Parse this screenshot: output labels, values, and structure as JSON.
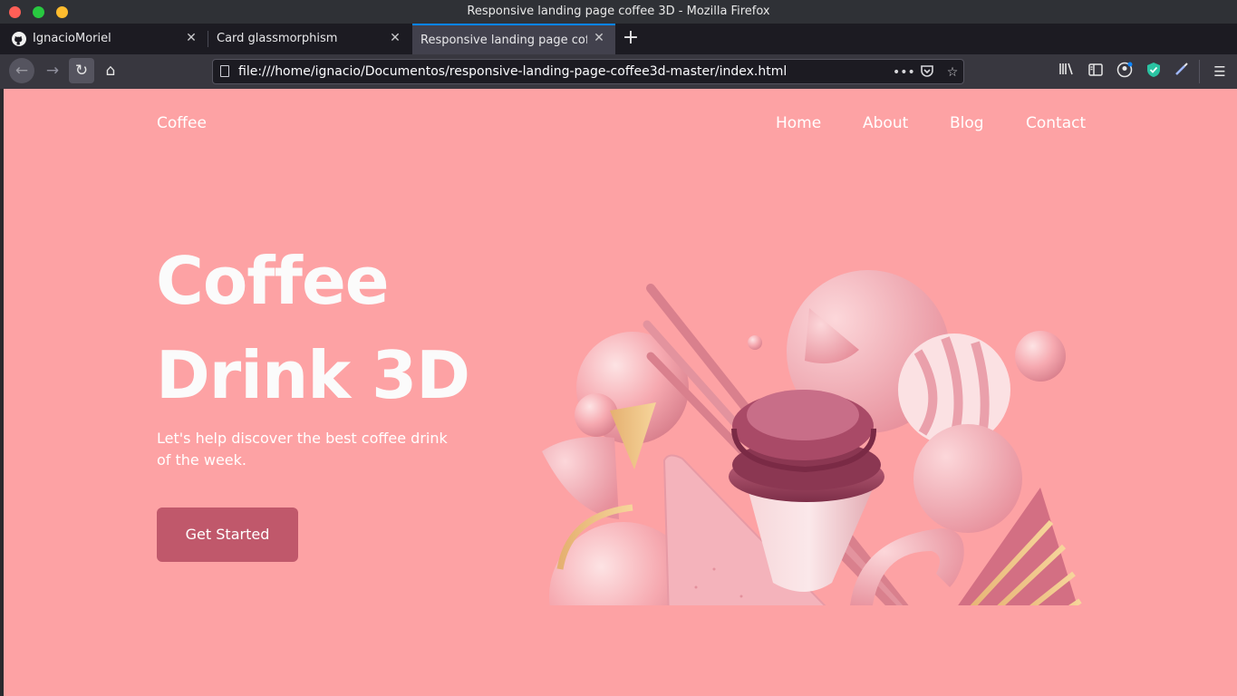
{
  "window": {
    "title": "Responsive landing page coffee 3D - Mozilla Firefox"
  },
  "tabs": [
    {
      "label": "IgnacioMoriel",
      "icon": "github-icon"
    },
    {
      "label": "Card glassmorphism"
    },
    {
      "label": "Responsive landing page coffee 3D",
      "active": true
    }
  ],
  "address": {
    "url": "file:///home/ignacio/Documentos/responsive-landing-page-coffee3d-master/index.html"
  },
  "page": {
    "logo": "Coffee",
    "nav": [
      "Home",
      "About",
      "Blog",
      "Contact"
    ],
    "title_line1": "Coffee",
    "title_line2": "Drink 3D",
    "subtitle": "Let's help discover the best coffee drink of the week.",
    "cta": "Get Started"
  },
  "colors": {
    "background": "#fda2a4",
    "button": "#c0586b",
    "accent": "#0a84ff"
  }
}
